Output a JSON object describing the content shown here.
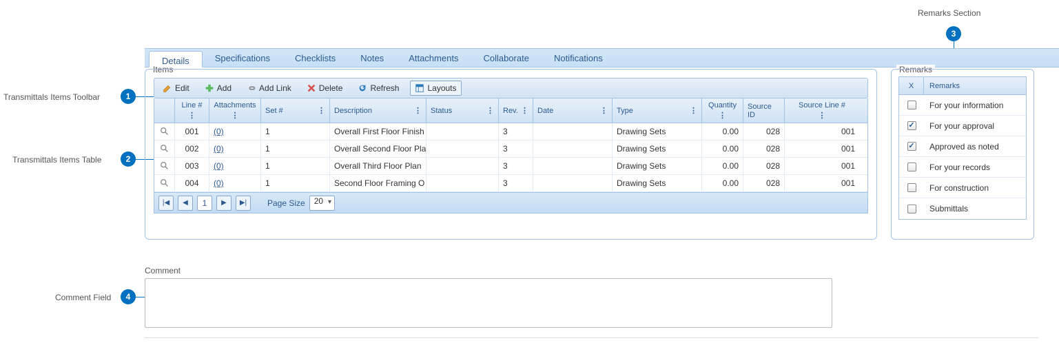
{
  "callouts": {
    "c1_label": "Transmittals Items Toolbar",
    "c1_num": "1",
    "c2_label": "Transmittals Items Table",
    "c2_num": "2",
    "c3_label": "Remarks Section",
    "c3_num": "3",
    "c4_label": "Comment Field",
    "c4_num": "4"
  },
  "tabs": [
    "Details",
    "Specifications",
    "Checklists",
    "Notes",
    "Attachments",
    "Collaborate",
    "Notifications"
  ],
  "items_legend": "Items",
  "toolbar": {
    "edit": "Edit",
    "add": "Add",
    "add_link": "Add Link",
    "delete": "Delete",
    "refresh": "Refresh",
    "layouts": "Layouts"
  },
  "columns": {
    "line": "Line #",
    "att": "Attachments",
    "set": "Set #",
    "desc": "Description",
    "status": "Status",
    "rev": "Rev.",
    "date": "Date",
    "type": "Type",
    "qty": "Quantity",
    "srcid": "Source ID",
    "sline": "Source Line #"
  },
  "rows": [
    {
      "line": "001",
      "att": "(0)",
      "set": "1",
      "desc": "Overall First Floor Finish",
      "status": "",
      "rev": "3",
      "date": "",
      "type": "Drawing Sets",
      "qty": "0.00",
      "srcid": "028",
      "sline": "001"
    },
    {
      "line": "002",
      "att": "(0)",
      "set": "1",
      "desc": "Overall Second Floor Pla",
      "status": "",
      "rev": "3",
      "date": "",
      "type": "Drawing Sets",
      "qty": "0.00",
      "srcid": "028",
      "sline": "001"
    },
    {
      "line": "003",
      "att": "(0)",
      "set": "1",
      "desc": "Overall Third Floor Plan",
      "status": "",
      "rev": "3",
      "date": "",
      "type": "Drawing Sets",
      "qty": "0.00",
      "srcid": "028",
      "sline": "001"
    },
    {
      "line": "004",
      "att": "(0)",
      "set": "1",
      "desc": "Second Floor Framing O",
      "status": "",
      "rev": "3",
      "date": "",
      "type": "Drawing Sets",
      "qty": "0.00",
      "srcid": "028",
      "sline": "001"
    }
  ],
  "pager": {
    "page": "1",
    "page_size_label": "Page Size",
    "page_size": "20"
  },
  "remarks_legend": "Remarks",
  "remarks_cols": {
    "x": "X",
    "remarks": "Remarks"
  },
  "remarks": [
    {
      "checked": false,
      "label": "For your information"
    },
    {
      "checked": true,
      "label": "For your approval"
    },
    {
      "checked": true,
      "label": "Approved as noted"
    },
    {
      "checked": false,
      "label": "For your records"
    },
    {
      "checked": false,
      "label": "For construction"
    },
    {
      "checked": false,
      "label": "Submittals"
    }
  ],
  "comment_label": "Comment",
  "comment_value": ""
}
